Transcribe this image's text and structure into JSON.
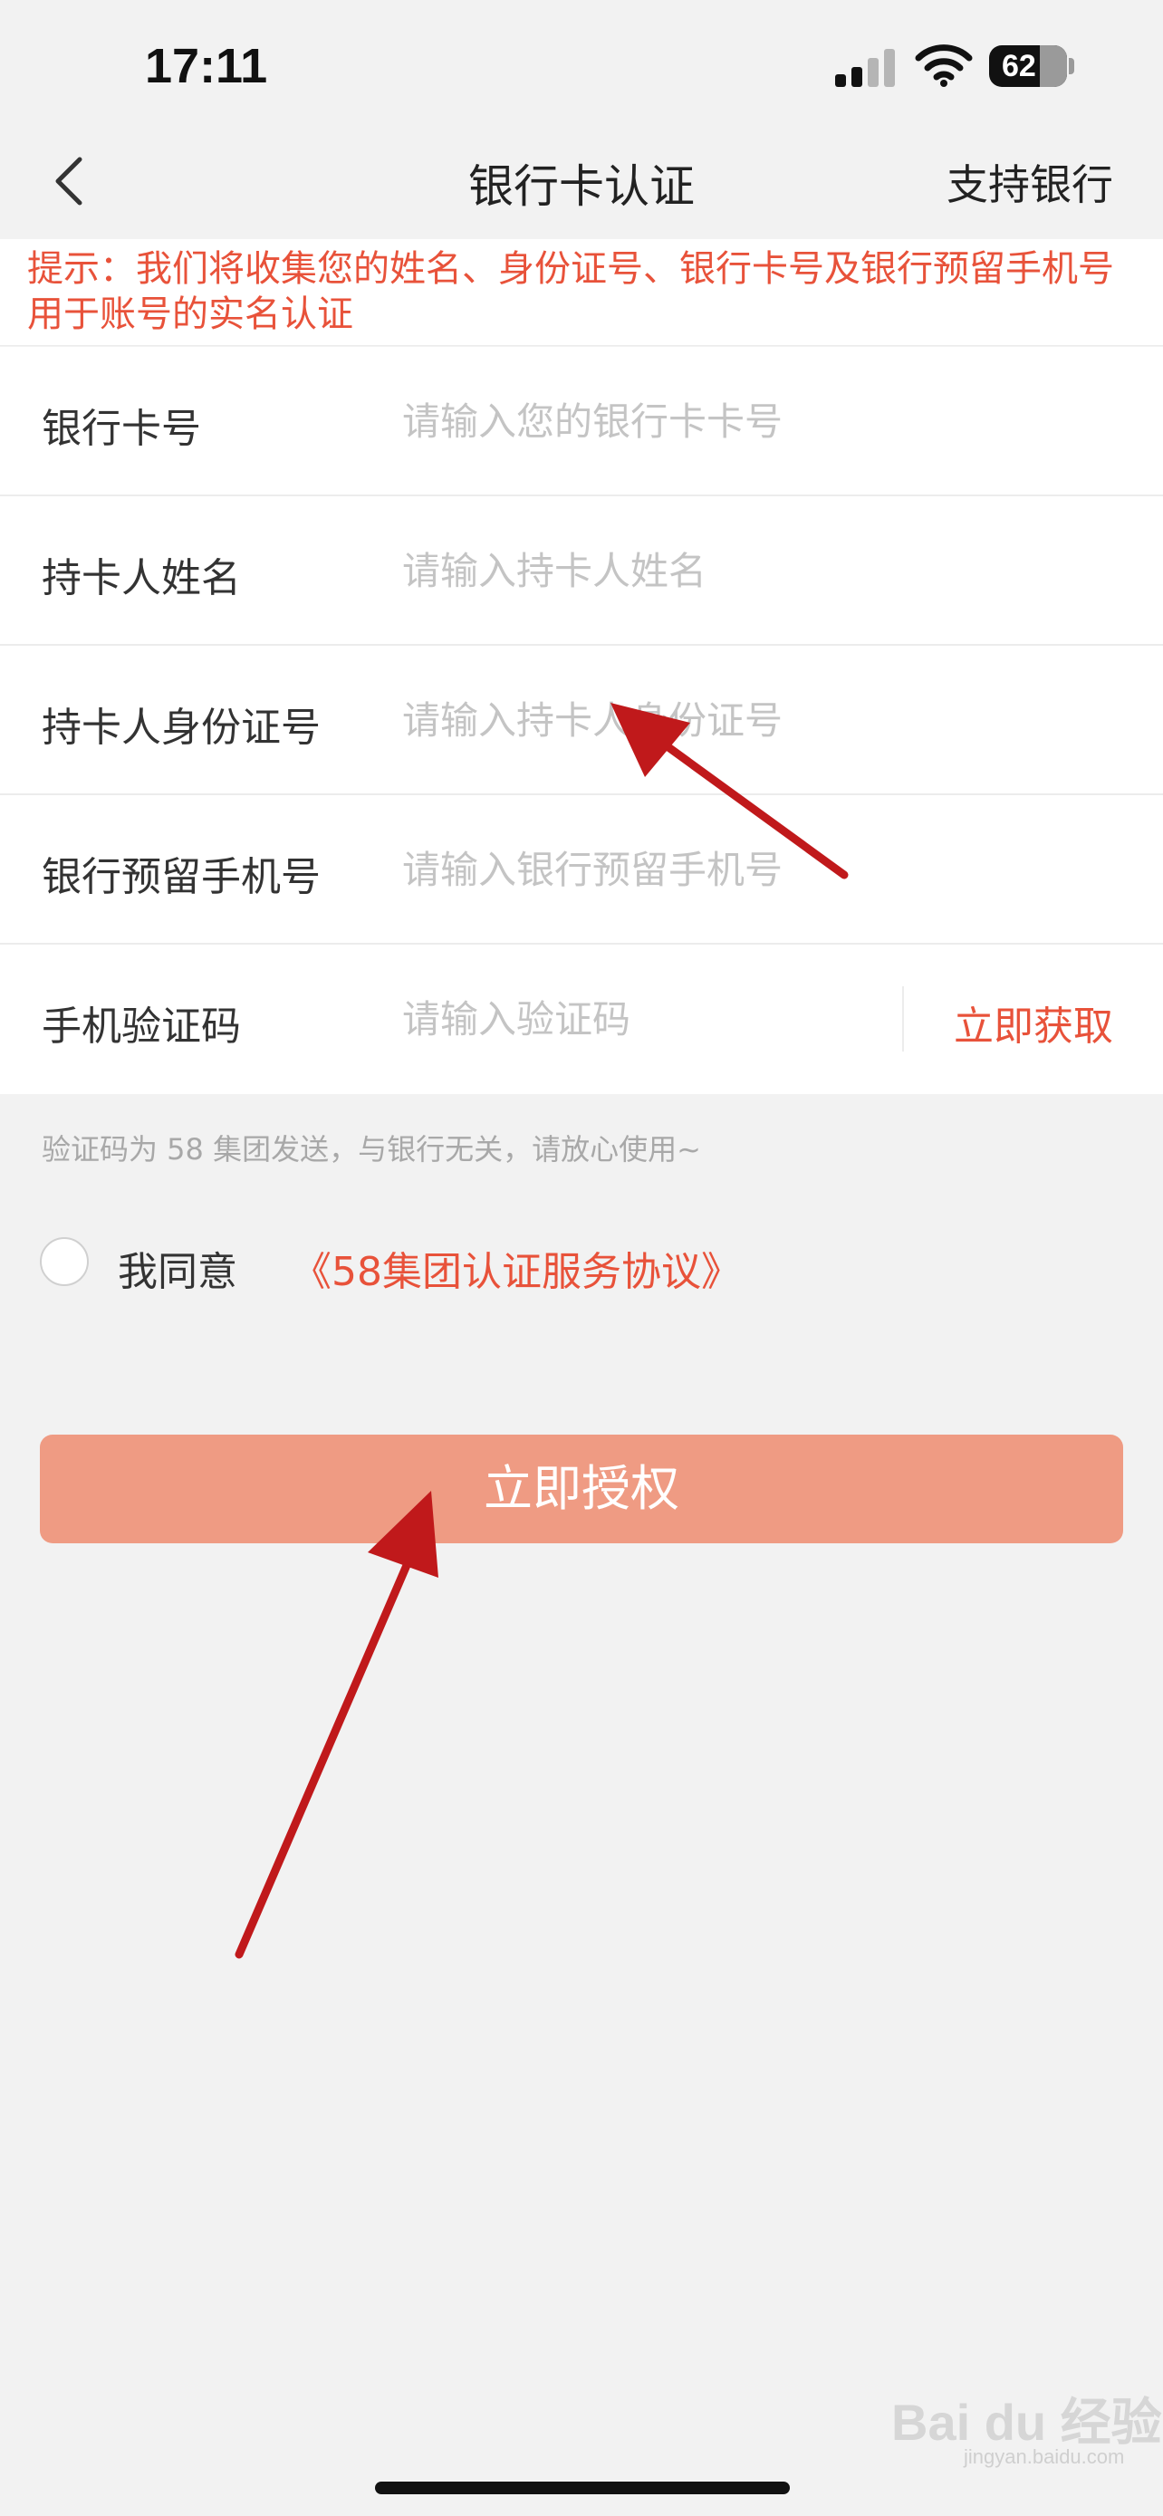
{
  "status_bar": {
    "time": "17:11",
    "battery": "62",
    "icons": [
      "signal-icon",
      "wifi-icon",
      "battery-icon"
    ]
  },
  "nav": {
    "back_icon": "chevron-left-icon",
    "title": "银行卡认证",
    "right_action": "支持银行"
  },
  "notice": {
    "text": "提示：我们将收集您的姓名、身份证号、银行卡号及银行预留手机号用于账号的实名认证"
  },
  "form": {
    "fields": [
      {
        "label": "银行卡号",
        "placeholder": "请输入您的银行卡卡号",
        "value": ""
      },
      {
        "label": "持卡人姓名",
        "placeholder": "请输入持卡人姓名",
        "value": ""
      },
      {
        "label": "持卡人身份证号",
        "placeholder": "请输入持卡人身份证号",
        "value": ""
      },
      {
        "label": "银行预留手机号",
        "placeholder": "请输入银行预留手机号",
        "value": ""
      },
      {
        "label": "手机验证码",
        "placeholder": "请输入验证码",
        "value": ""
      }
    ],
    "get_code": "立即获取",
    "hint": "验证码为 58 集团发送，与银行无关，请放心使用~"
  },
  "agreement": {
    "text": "我同意",
    "link": "《58集团认证服务协议》",
    "checked": false
  },
  "button": {
    "label": "立即授权"
  },
  "watermark": {
    "text": "Bai du 经验",
    "sub": "jingyan.baidu.com"
  },
  "colors": {
    "accent": "#e8523a",
    "button_bg": "#ef9b83",
    "arrow": "#c0191b",
    "page_bg": "#f2f2f2"
  }
}
